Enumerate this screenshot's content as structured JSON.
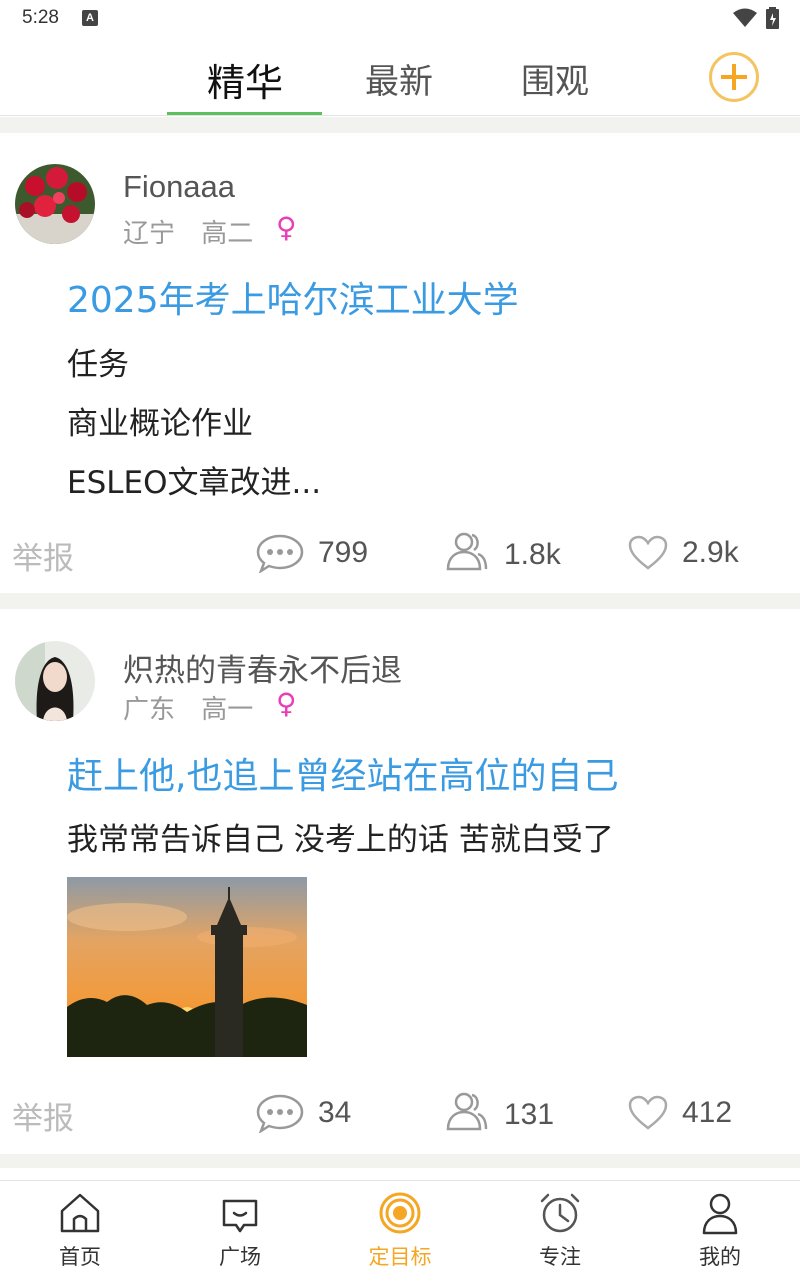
{
  "status_bar": {
    "time": "5:28"
  },
  "top_tabs": [
    {
      "label": "精华",
      "active": true
    },
    {
      "label": "最新",
      "active": false
    },
    {
      "label": "围观",
      "active": false
    }
  ],
  "posts": [
    {
      "username": "Fionaaa",
      "province": "辽宁",
      "grade": "高二",
      "gender": "♀",
      "title": "2025年考上哈尔滨工业大学",
      "lines": [
        "任务",
        "商业概论作业",
        "ESLEO文章改进..."
      ],
      "report": "举报",
      "comments": "799",
      "followers": "1.8k",
      "likes": "2.9k"
    },
    {
      "username": "炽热的青春永不后退",
      "province": "广东",
      "grade": "高一",
      "gender": "♀",
      "title": "赶上他,也追上曾经站在高位的自己",
      "lines": [
        "我常常告诉自己 没考上的话 苦就白受了"
      ],
      "report": "举报",
      "comments": "34",
      "followers": "131",
      "likes": "412"
    }
  ],
  "bottom_nav": [
    {
      "label": "首页",
      "icon": "home-icon",
      "active": false
    },
    {
      "label": "广场",
      "icon": "square-chat-icon",
      "active": false
    },
    {
      "label": "定目标",
      "icon": "target-icon",
      "active": true
    },
    {
      "label": "专注",
      "icon": "alarm-clock-icon",
      "active": false
    },
    {
      "label": "我的",
      "icon": "person-icon",
      "active": false
    }
  ],
  "colors": {
    "accent_green": "#5cc15a",
    "accent_orange": "#f5a623",
    "title_blue": "#3a9be2",
    "gender_pink": "#e83fb8"
  }
}
